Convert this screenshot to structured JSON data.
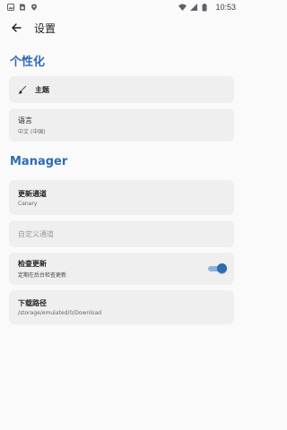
{
  "status_bar": {
    "time": "10:53",
    "left_icons": [
      "image-icon",
      "sim-icon",
      "location-icon"
    ],
    "right_icons": [
      "wifi-icon",
      "signal-icon",
      "battery-icon"
    ]
  },
  "app_bar": {
    "back_icon": "back-arrow-icon",
    "title": "设置"
  },
  "sections": {
    "personalization": {
      "header": "个性化",
      "theme": {
        "icon": "brush-icon",
        "label": "主题"
      },
      "language": {
        "label": "语言",
        "value": "中文 (中国)"
      }
    },
    "manager": {
      "header": "Manager",
      "update_channel": {
        "label": "更新通道",
        "value": "Canary"
      },
      "custom_channel": {
        "placeholder": "自定义通道"
      },
      "check_updates": {
        "label": "检查更新",
        "description": "定期在后台检查更新",
        "enabled": true
      },
      "download_path": {
        "label": "下载路径",
        "value": "/storage/emulated/0/Download"
      }
    }
  },
  "colors": {
    "accent": "#2f6bb0",
    "card_bg": "#efefef",
    "page_bg": "#fafafa"
  }
}
